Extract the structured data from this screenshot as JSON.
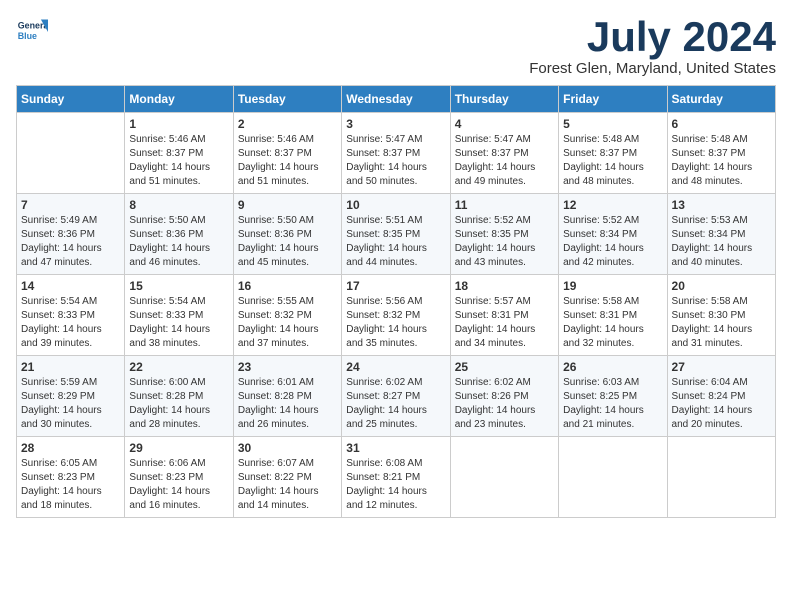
{
  "header": {
    "logo_line1": "General",
    "logo_line2": "Blue",
    "title": "July 2024",
    "subtitle": "Forest Glen, Maryland, United States"
  },
  "days_of_week": [
    "Sunday",
    "Monday",
    "Tuesday",
    "Wednesday",
    "Thursday",
    "Friday",
    "Saturday"
  ],
  "weeks": [
    [
      {
        "num": "",
        "info": ""
      },
      {
        "num": "1",
        "info": "Sunrise: 5:46 AM\nSunset: 8:37 PM\nDaylight: 14 hours\nand 51 minutes."
      },
      {
        "num": "2",
        "info": "Sunrise: 5:46 AM\nSunset: 8:37 PM\nDaylight: 14 hours\nand 51 minutes."
      },
      {
        "num": "3",
        "info": "Sunrise: 5:47 AM\nSunset: 8:37 PM\nDaylight: 14 hours\nand 50 minutes."
      },
      {
        "num": "4",
        "info": "Sunrise: 5:47 AM\nSunset: 8:37 PM\nDaylight: 14 hours\nand 49 minutes."
      },
      {
        "num": "5",
        "info": "Sunrise: 5:48 AM\nSunset: 8:37 PM\nDaylight: 14 hours\nand 48 minutes."
      },
      {
        "num": "6",
        "info": "Sunrise: 5:48 AM\nSunset: 8:37 PM\nDaylight: 14 hours\nand 48 minutes."
      }
    ],
    [
      {
        "num": "7",
        "info": "Sunrise: 5:49 AM\nSunset: 8:36 PM\nDaylight: 14 hours\nand 47 minutes."
      },
      {
        "num": "8",
        "info": "Sunrise: 5:50 AM\nSunset: 8:36 PM\nDaylight: 14 hours\nand 46 minutes."
      },
      {
        "num": "9",
        "info": "Sunrise: 5:50 AM\nSunset: 8:36 PM\nDaylight: 14 hours\nand 45 minutes."
      },
      {
        "num": "10",
        "info": "Sunrise: 5:51 AM\nSunset: 8:35 PM\nDaylight: 14 hours\nand 44 minutes."
      },
      {
        "num": "11",
        "info": "Sunrise: 5:52 AM\nSunset: 8:35 PM\nDaylight: 14 hours\nand 43 minutes."
      },
      {
        "num": "12",
        "info": "Sunrise: 5:52 AM\nSunset: 8:34 PM\nDaylight: 14 hours\nand 42 minutes."
      },
      {
        "num": "13",
        "info": "Sunrise: 5:53 AM\nSunset: 8:34 PM\nDaylight: 14 hours\nand 40 minutes."
      }
    ],
    [
      {
        "num": "14",
        "info": "Sunrise: 5:54 AM\nSunset: 8:33 PM\nDaylight: 14 hours\nand 39 minutes."
      },
      {
        "num": "15",
        "info": "Sunrise: 5:54 AM\nSunset: 8:33 PM\nDaylight: 14 hours\nand 38 minutes."
      },
      {
        "num": "16",
        "info": "Sunrise: 5:55 AM\nSunset: 8:32 PM\nDaylight: 14 hours\nand 37 minutes."
      },
      {
        "num": "17",
        "info": "Sunrise: 5:56 AM\nSunset: 8:32 PM\nDaylight: 14 hours\nand 35 minutes."
      },
      {
        "num": "18",
        "info": "Sunrise: 5:57 AM\nSunset: 8:31 PM\nDaylight: 14 hours\nand 34 minutes."
      },
      {
        "num": "19",
        "info": "Sunrise: 5:58 AM\nSunset: 8:31 PM\nDaylight: 14 hours\nand 32 minutes."
      },
      {
        "num": "20",
        "info": "Sunrise: 5:58 AM\nSunset: 8:30 PM\nDaylight: 14 hours\nand 31 minutes."
      }
    ],
    [
      {
        "num": "21",
        "info": "Sunrise: 5:59 AM\nSunset: 8:29 PM\nDaylight: 14 hours\nand 30 minutes."
      },
      {
        "num": "22",
        "info": "Sunrise: 6:00 AM\nSunset: 8:28 PM\nDaylight: 14 hours\nand 28 minutes."
      },
      {
        "num": "23",
        "info": "Sunrise: 6:01 AM\nSunset: 8:28 PM\nDaylight: 14 hours\nand 26 minutes."
      },
      {
        "num": "24",
        "info": "Sunrise: 6:02 AM\nSunset: 8:27 PM\nDaylight: 14 hours\nand 25 minutes."
      },
      {
        "num": "25",
        "info": "Sunrise: 6:02 AM\nSunset: 8:26 PM\nDaylight: 14 hours\nand 23 minutes."
      },
      {
        "num": "26",
        "info": "Sunrise: 6:03 AM\nSunset: 8:25 PM\nDaylight: 14 hours\nand 21 minutes."
      },
      {
        "num": "27",
        "info": "Sunrise: 6:04 AM\nSunset: 8:24 PM\nDaylight: 14 hours\nand 20 minutes."
      }
    ],
    [
      {
        "num": "28",
        "info": "Sunrise: 6:05 AM\nSunset: 8:23 PM\nDaylight: 14 hours\nand 18 minutes."
      },
      {
        "num": "29",
        "info": "Sunrise: 6:06 AM\nSunset: 8:23 PM\nDaylight: 14 hours\nand 16 minutes."
      },
      {
        "num": "30",
        "info": "Sunrise: 6:07 AM\nSunset: 8:22 PM\nDaylight: 14 hours\nand 14 minutes."
      },
      {
        "num": "31",
        "info": "Sunrise: 6:08 AM\nSunset: 8:21 PM\nDaylight: 14 hours\nand 12 minutes."
      },
      {
        "num": "",
        "info": ""
      },
      {
        "num": "",
        "info": ""
      },
      {
        "num": "",
        "info": ""
      }
    ]
  ]
}
